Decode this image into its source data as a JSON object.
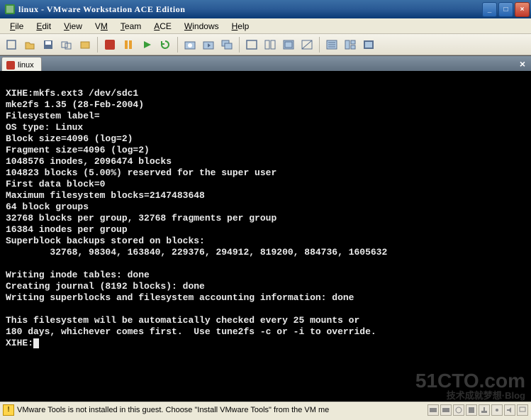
{
  "window": {
    "title": "linux - VMware Workstation ACE Edition",
    "minimize": "_",
    "maximize": "□",
    "close": "×"
  },
  "menu": {
    "file": "File",
    "edit": "Edit",
    "view": "View",
    "vm": "VM",
    "team": "Team",
    "ace": "ACE",
    "windows": "Windows",
    "help": "Help"
  },
  "vmtab": {
    "label": "linux",
    "close": "×"
  },
  "terminal": {
    "lines": [
      "",
      "XIHE:mkfs.ext3 /dev/sdc1",
      "mke2fs 1.35 (28-Feb-2004)",
      "Filesystem label=",
      "OS type: Linux",
      "Block size=4096 (log=2)",
      "Fragment size=4096 (log=2)",
      "1048576 inodes, 2096474 blocks",
      "104823 blocks (5.00%) reserved for the super user",
      "First data block=0",
      "Maximum filesystem blocks=2147483648",
      "64 block groups",
      "32768 blocks per group, 32768 fragments per group",
      "16384 inodes per group",
      "Superblock backups stored on blocks:",
      "        32768, 98304, 163840, 229376, 294912, 819200, 884736, 1605632",
      "",
      "Writing inode tables: done",
      "Creating journal (8192 blocks): done",
      "Writing superblocks and filesystem accounting information: done",
      "",
      "This filesystem will be automatically checked every 25 mounts or",
      "180 days, whichever comes first.  Use tune2fs -c or -i to override."
    ],
    "prompt": "XIHE:"
  },
  "statusbar": {
    "message": "VMware Tools is not installed in this guest. Choose \"Install VMware Tools\" from the VM me"
  },
  "watermark": {
    "text": "51CTO.com",
    "sub": "技术成就梦想·Blog"
  },
  "toolbar_icons": {
    "power_off": "⏻",
    "suspend": "⏸",
    "power_on": "▶",
    "reset": "↻",
    "snapshot": "📷",
    "revert": "↶",
    "manage": "🗂",
    "fullscreen": "⛶",
    "unity": "◫",
    "console": "▭",
    "quickswitch": "◧",
    "summary": "📋",
    "appliance": "🧩",
    "inventory": "🗄"
  }
}
